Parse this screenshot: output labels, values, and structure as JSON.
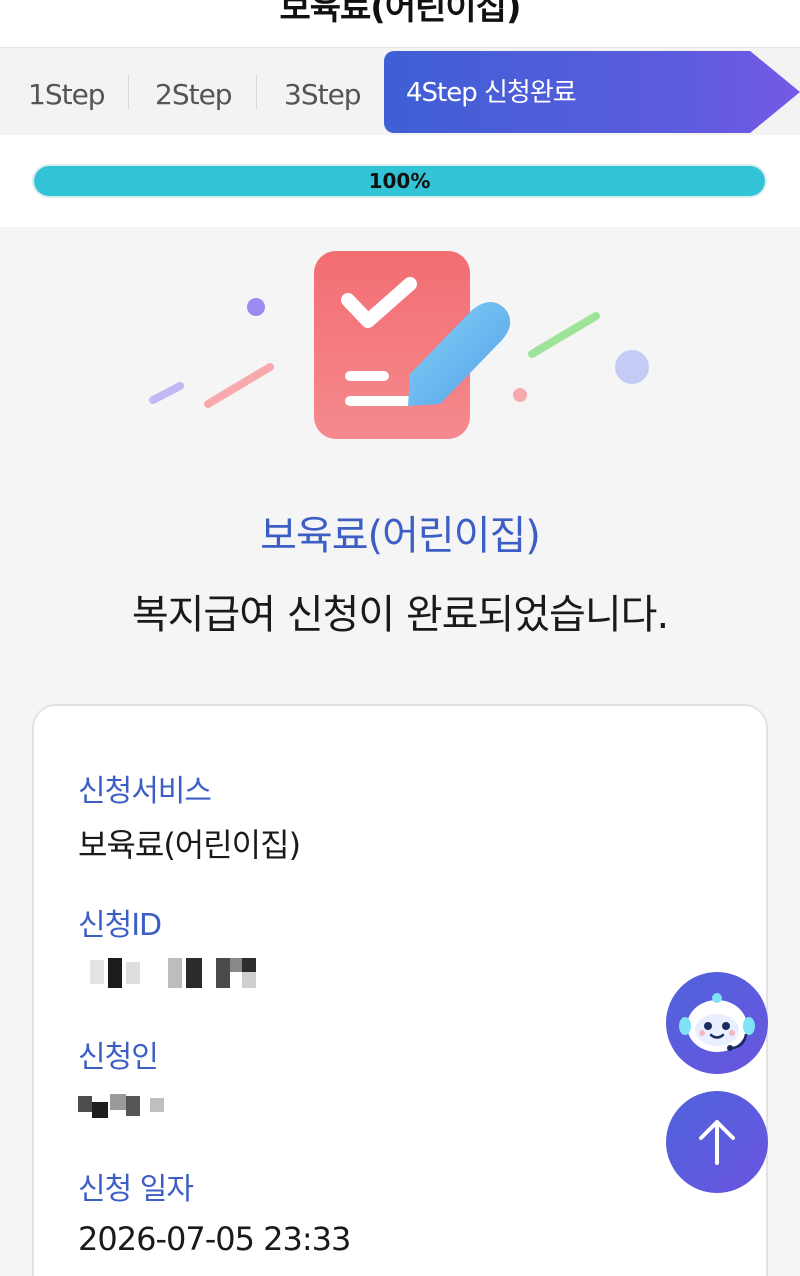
{
  "header": {
    "title": "보육료(어린이집)"
  },
  "steps": {
    "items": [
      {
        "label": "1Step"
      },
      {
        "label": "2Step"
      },
      {
        "label": "3Step"
      }
    ],
    "active": {
      "label": "4Step 신청완료"
    }
  },
  "progress": {
    "label": "100%",
    "value": 1.0
  },
  "headline": {
    "service": "보육료(어린이집)",
    "message": "복지급여 신청이 완료되었습니다."
  },
  "details": {
    "service_label": "신청서비스",
    "service_value": "보육료(어린이집)",
    "id_label": "신청ID",
    "applicant_label": "신청인",
    "date_label": "신청 일자",
    "date_value": "2026-07-05 23:33"
  },
  "colors": {
    "accent": "#3d5fc5",
    "progress": "#33c3d6",
    "step_active_start": "#3f5fd4",
    "step_active_end": "#7658e6"
  },
  "icons": {
    "illustration": "checklist-pencil-icon",
    "chatbot": "chatbot-robot-icon",
    "scroll_top": "arrow-up-icon"
  }
}
